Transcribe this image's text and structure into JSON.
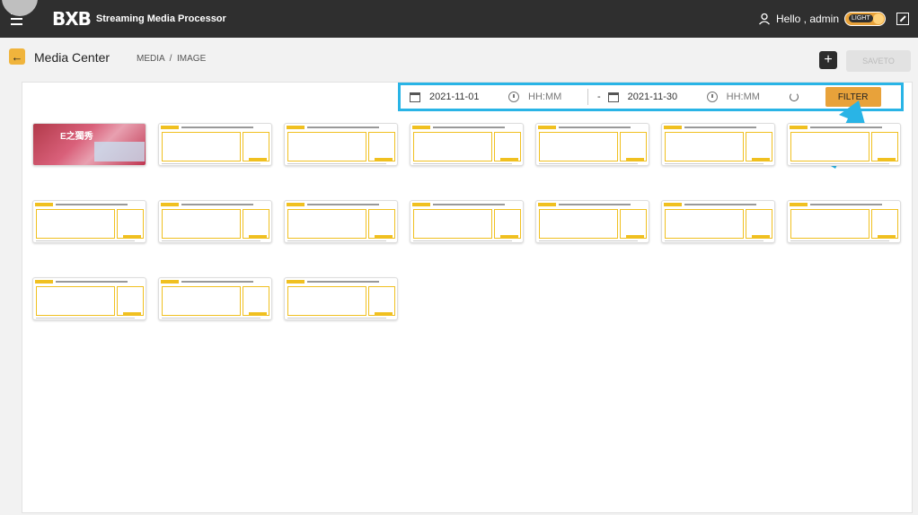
{
  "header": {
    "logo": "BXB",
    "app_title": "Streaming Media Processor",
    "greeting": "Hello , admin",
    "theme_toggle_label": "LIGHT"
  },
  "subheader": {
    "page_title": "Media Center",
    "breadcrumb": "MEDIA  /  IMAGE",
    "saveto_label": "SAVETO"
  },
  "filter": {
    "start_date": "2021-11-01",
    "start_time_placeholder": "HH:MM",
    "separator": "-",
    "end_date": "2021-11-30",
    "end_time_placeholder": "HH:MM",
    "filter_label": "FILTER"
  },
  "colors": {
    "accent": "#e8a23a",
    "highlight": "#29b4e6",
    "topbar": "#2f2f2f"
  },
  "thumbnails": [
    {
      "kind": "photo",
      "text": "E之獨秀"
    },
    {
      "kind": "doc"
    },
    {
      "kind": "doc"
    },
    {
      "kind": "doc"
    },
    {
      "kind": "doc"
    },
    {
      "kind": "doc"
    },
    {
      "kind": "doc"
    },
    {
      "kind": "doc"
    },
    {
      "kind": "doc"
    },
    {
      "kind": "doc"
    },
    {
      "kind": "doc"
    },
    {
      "kind": "doc"
    },
    {
      "kind": "doc"
    },
    {
      "kind": "doc"
    },
    {
      "kind": "doc"
    },
    {
      "kind": "doc"
    },
    {
      "kind": "doc"
    }
  ]
}
